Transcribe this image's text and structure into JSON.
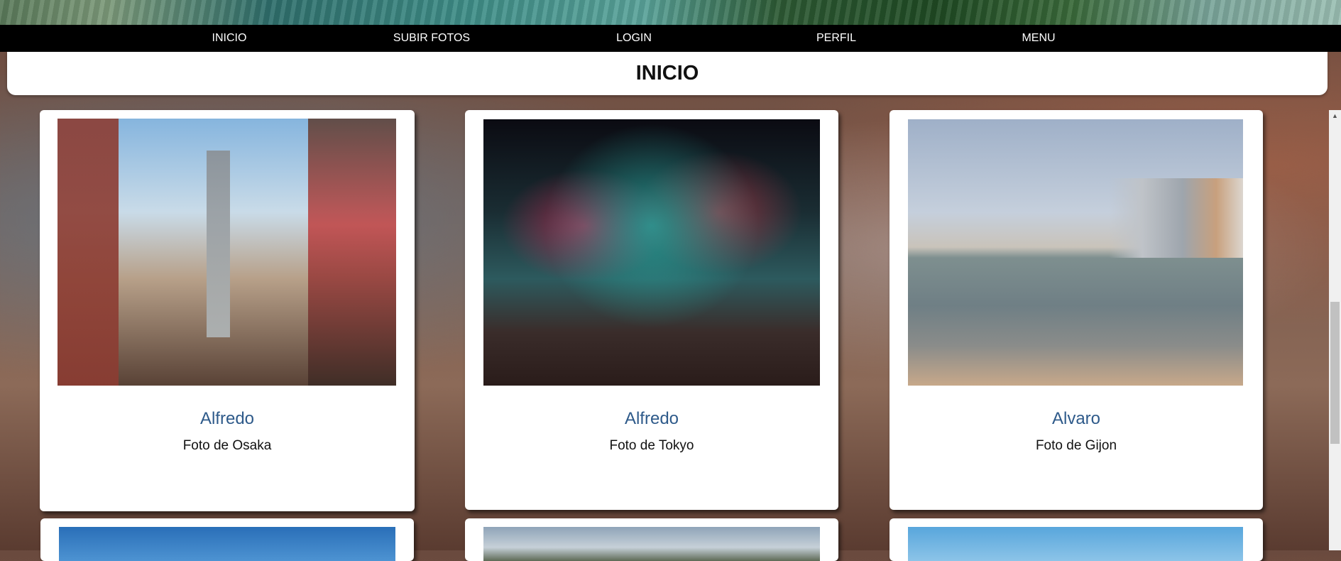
{
  "nav": {
    "items": [
      {
        "label": "INICIO"
      },
      {
        "label": "SUBIR FOTOS"
      },
      {
        "label": "LOGIN"
      },
      {
        "label": "PERFIL"
      },
      {
        "label": "MENU"
      }
    ]
  },
  "page": {
    "title": "INICIO"
  },
  "cards": [
    {
      "author": "Alfredo",
      "caption": "Foto de Osaka",
      "image": "osaka-street-photo"
    },
    {
      "author": "Alfredo",
      "caption": "Foto de Tokyo",
      "image": "tokyo-night-photo"
    },
    {
      "author": "Alvaro",
      "caption": "Foto de Gijon",
      "image": "gijon-beach-photo"
    }
  ]
}
